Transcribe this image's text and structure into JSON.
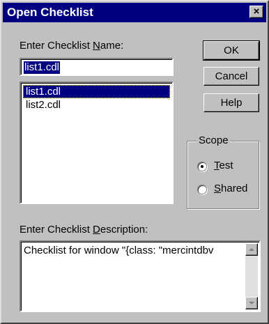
{
  "window": {
    "title": "Open Checklist",
    "close_glyph": "×"
  },
  "name_label": {
    "pre": "Enter Checklist ",
    "accel": "N",
    "post": "ame:"
  },
  "name_input": {
    "value": "list1.cdl"
  },
  "list": {
    "items": [
      "list1.cdl",
      "list2.cdl"
    ],
    "selected_index": 0
  },
  "buttons": {
    "ok": "OK",
    "cancel": "Cancel",
    "help": "Help"
  },
  "scope": {
    "legend": "Scope",
    "options": [
      {
        "accel": "T",
        "rest": "est",
        "checked": true
      },
      {
        "accel": "S",
        "rest": "hared",
        "checked": false
      }
    ]
  },
  "desc_label": {
    "pre": "Enter Checklist ",
    "accel": "D",
    "post": "escription:"
  },
  "description": {
    "value": "Checklist for window \"{class: \"mercintdbv"
  },
  "colors": {
    "titlebar": "#000080",
    "face": "#c0c0c0",
    "selection": "#000080"
  }
}
